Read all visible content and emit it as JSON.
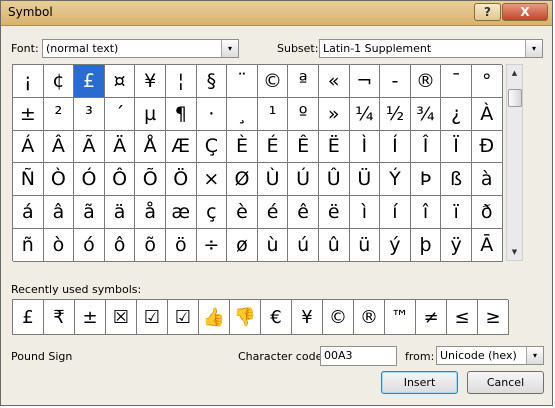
{
  "window": {
    "title": "Symbol",
    "help_label": "?",
    "close_label": "X"
  },
  "font": {
    "label": "Font:",
    "value": "(normal text)"
  },
  "subset": {
    "label": "Subset:",
    "value": "Latin-1 Supplement"
  },
  "symbols": [
    "¡",
    "¢",
    "£",
    "¤",
    "¥",
    "¦",
    "§",
    "¨",
    "©",
    "ª",
    "«",
    "¬",
    "-",
    "®",
    "¯",
    "°",
    "±",
    "²",
    "³",
    "´",
    "µ",
    "¶",
    "·",
    "¸",
    "¹",
    "º",
    "»",
    "¼",
    "½",
    "¾",
    "¿",
    "À",
    "Á",
    "Â",
    "Ã",
    "Ä",
    "Å",
    "Æ",
    "Ç",
    "È",
    "É",
    "Ê",
    "Ë",
    "Ì",
    "Í",
    "Î",
    "Ï",
    "Đ",
    "Ñ",
    "Ò",
    "Ó",
    "Ô",
    "Õ",
    "Ö",
    "×",
    "Ø",
    "Ù",
    "Ú",
    "Û",
    "Ü",
    "Ý",
    "Þ",
    "ß",
    "à",
    "á",
    "â",
    "ã",
    "ä",
    "å",
    "æ",
    "ç",
    "è",
    "é",
    "ê",
    "ë",
    "ì",
    "í",
    "î",
    "ï",
    "ð",
    "ñ",
    "ò",
    "ó",
    "ô",
    "õ",
    "ö",
    "÷",
    "ø",
    "ù",
    "ú",
    "û",
    "ü",
    "ý",
    "þ",
    "ÿ",
    "Ā"
  ],
  "selected_index": 2,
  "recent": {
    "label": "Recently used symbols:",
    "items": [
      "£",
      "₹",
      "±",
      "☒",
      "☑",
      "☑",
      "👍",
      "👎",
      "€",
      "¥",
      "©",
      "®",
      "™",
      "≠",
      "≤",
      "≥"
    ]
  },
  "status": {
    "char_name": "Pound Sign"
  },
  "char_code": {
    "label": "Character code:",
    "value": "00A3"
  },
  "from": {
    "label": "from:",
    "value": "Unicode (hex)"
  },
  "buttons": {
    "insert": "Insert",
    "cancel": "Cancel"
  },
  "icons": {
    "dropdown": "▾",
    "scroll_up": "▲",
    "scroll_down": "▼"
  }
}
